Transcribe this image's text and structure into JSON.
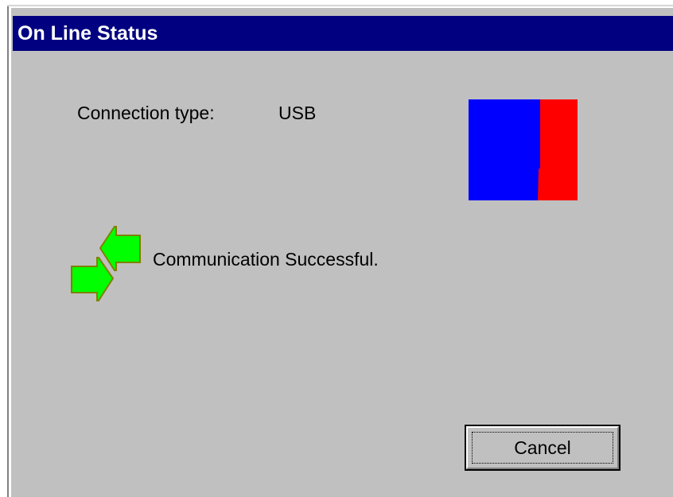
{
  "window": {
    "title": "On Line Status"
  },
  "connection": {
    "label": "Connection type:",
    "value": "USB"
  },
  "status": {
    "message": "Communication Successful.",
    "icon": "communication-arrows-icon"
  },
  "indicator": {
    "left_color": "#0000ff",
    "right_color": "#ff0000"
  },
  "buttons": {
    "cancel_label": "Cancel"
  },
  "colors": {
    "titlebar": "#000080",
    "dialog_bg": "#c0c0c0",
    "arrow_green": "#00ff00",
    "arrow_edge": "#808000"
  }
}
